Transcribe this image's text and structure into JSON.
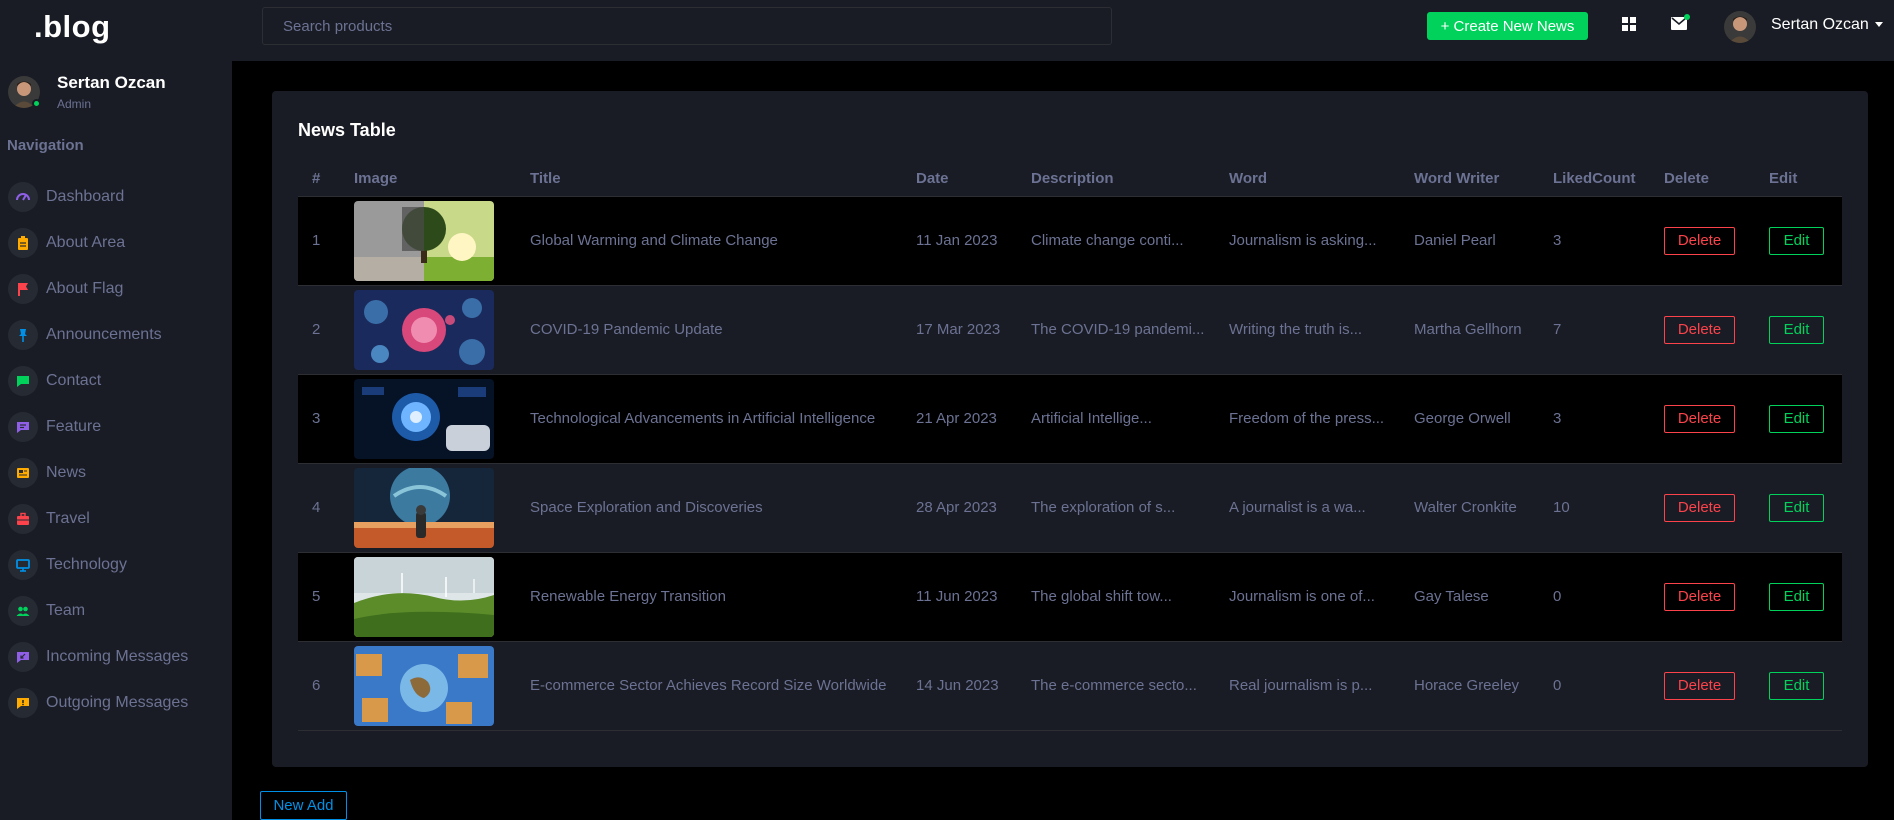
{
  "app": {
    "logo": ".blog"
  },
  "header": {
    "search_placeholder": "Search products",
    "create_button": "+ Create New News",
    "user_name": "Sertan Ozcan",
    "icons": [
      "grid-icon",
      "mail-icon",
      "avatar"
    ]
  },
  "sidebar": {
    "profile": {
      "name": "Sertan Ozcan",
      "role": "Admin",
      "status": "online"
    },
    "nav_title": "Navigation",
    "items": [
      {
        "label": "Dashboard",
        "icon": "speedometer-icon",
        "color": "#8f5fe8"
      },
      {
        "label": "About Area",
        "icon": "clipboard-icon",
        "color": "#ffab00"
      },
      {
        "label": "About Flag",
        "icon": "flag-icon",
        "color": "#fc424a"
      },
      {
        "label": "Announcements",
        "icon": "pin-icon",
        "color": "#0090e7"
      },
      {
        "label": "Contact",
        "icon": "chat-icon",
        "color": "#00d25b"
      },
      {
        "label": "Feature",
        "icon": "message-icon",
        "color": "#8f5fe8"
      },
      {
        "label": "News",
        "icon": "news-icon",
        "color": "#ffab00"
      },
      {
        "label": "Travel",
        "icon": "briefcase-icon",
        "color": "#fc424a"
      },
      {
        "label": "Technology",
        "icon": "monitor-icon",
        "color": "#0090e7"
      },
      {
        "label": "Team",
        "icon": "people-icon",
        "color": "#00d25b"
      },
      {
        "label": "Incoming Messages",
        "icon": "message-in-icon",
        "color": "#8f5fe8"
      },
      {
        "label": "Outgoing Messages",
        "icon": "message-alert-icon",
        "color": "#ffab00"
      }
    ]
  },
  "main": {
    "card_title": "News Table",
    "columns": [
      "#",
      "Image",
      "Title",
      "Date",
      "Description",
      "Word",
      "Word Writer",
      "LikedCount",
      "Delete",
      "Edit"
    ],
    "rows": [
      {
        "num": "1",
        "image": "tree-half-dry-half-green",
        "title": "Global Warming and Climate Change",
        "date": "11 Jan 2023",
        "description": "Climate change conti...",
        "word": "Journalism is asking...",
        "writer": "Daniel Pearl",
        "liked": "3",
        "delete": "Delete",
        "edit": "Edit"
      },
      {
        "num": "2",
        "image": "virus-particles",
        "title": "COVID-19 Pandemic Update",
        "date": "17 Mar 2023",
        "description": "The COVID-19 pandemi...",
        "word": "Writing the truth is...",
        "writer": "Martha Gellhorn",
        "liked": "7",
        "delete": "Delete",
        "edit": "Edit"
      },
      {
        "num": "3",
        "image": "ai-digital-brain",
        "title": "Technological Advancements in Artificial Intelligence",
        "date": "21 Apr 2023",
        "description": "Artificial Intellige...",
        "word": "Freedom of the press...",
        "writer": "George Orwell",
        "liked": "3",
        "delete": "Delete",
        "edit": "Edit"
      },
      {
        "num": "4",
        "image": "astronaut-planet",
        "title": "Space Exploration and Discoveries",
        "date": "28 Apr 2023",
        "description": "The exploration of s...",
        "word": "A journalist is a wa...",
        "writer": "Walter Cronkite",
        "liked": "10",
        "delete": "Delete",
        "edit": "Edit"
      },
      {
        "num": "5",
        "image": "wind-turbines-hills",
        "title": "Renewable Energy Transition",
        "date": "11 Jun 2023",
        "description": "The global shift tow...",
        "word": "Journalism is one of...",
        "writer": "Gay Talese",
        "liked": "0",
        "delete": "Delete",
        "edit": "Edit"
      },
      {
        "num": "6",
        "image": "globe-with-boxes",
        "title": "E-commerce Sector Achieves Record Size Worldwide",
        "date": "14 Jun 2023",
        "description": "The e-commerce secto...",
        "word": "Real journalism is p...",
        "writer": "Horace Greeley",
        "liked": "0",
        "delete": "Delete",
        "edit": "Edit"
      }
    ],
    "new_add_button": "New Add"
  },
  "colors": {
    "background": "#000000",
    "panel": "#191c24",
    "muted_text": "#6c7293",
    "success": "#00d25b",
    "danger": "#fc424a",
    "primary": "#0090e7"
  }
}
